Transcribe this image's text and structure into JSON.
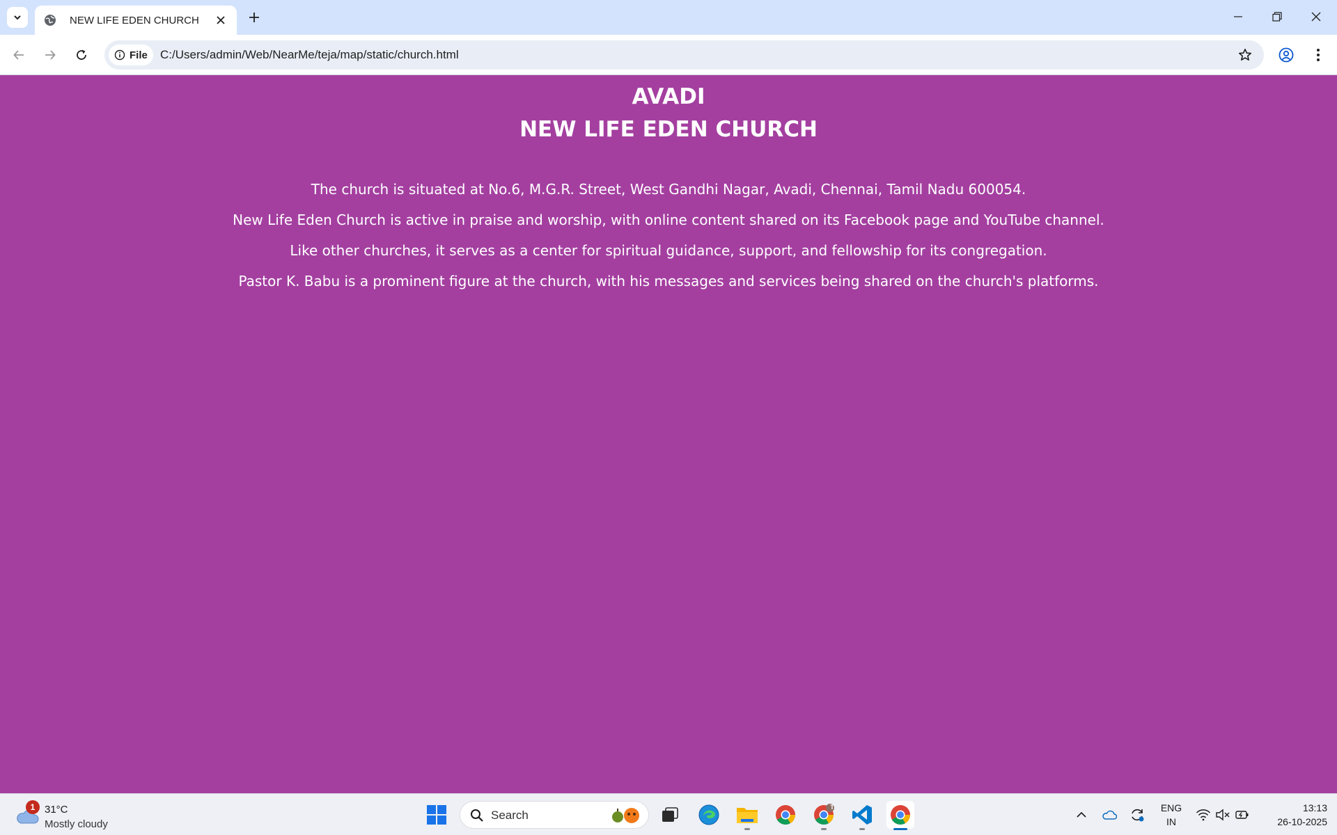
{
  "browser": {
    "tab_title": "NEW LIFE EDEN CHURCH",
    "site_chip_label": "File",
    "url": "C:/Users/admin/Web/NearMe/teja/map/static/church.html"
  },
  "page": {
    "city": "AVADI",
    "church_name": "NEW LIFE EDEN CHURCH",
    "paragraphs": [
      "The church is situated at No.6, M.G.R. Street, West Gandhi Nagar, Avadi, Chennai, Tamil Nadu 600054.",
      "New Life Eden Church is active in praise and worship, with online content shared on its Facebook page and YouTube channel.",
      "Like other churches, it serves as a center for spiritual guidance, support, and fellowship for its congregation.",
      "Pastor K. Babu is a prominent figure at the church, with his messages and services being shared on the church's platforms."
    ],
    "background_color": "#a43fa0"
  },
  "taskbar": {
    "weather": {
      "badge": "1",
      "temperature": "31°C",
      "condition": "Mostly cloudy"
    },
    "search_label": "Search",
    "language": {
      "line1": "ENG",
      "line2": "IN"
    },
    "clock": {
      "time": "13:13",
      "date": "26-10-2025"
    },
    "profile_badge": "T"
  }
}
